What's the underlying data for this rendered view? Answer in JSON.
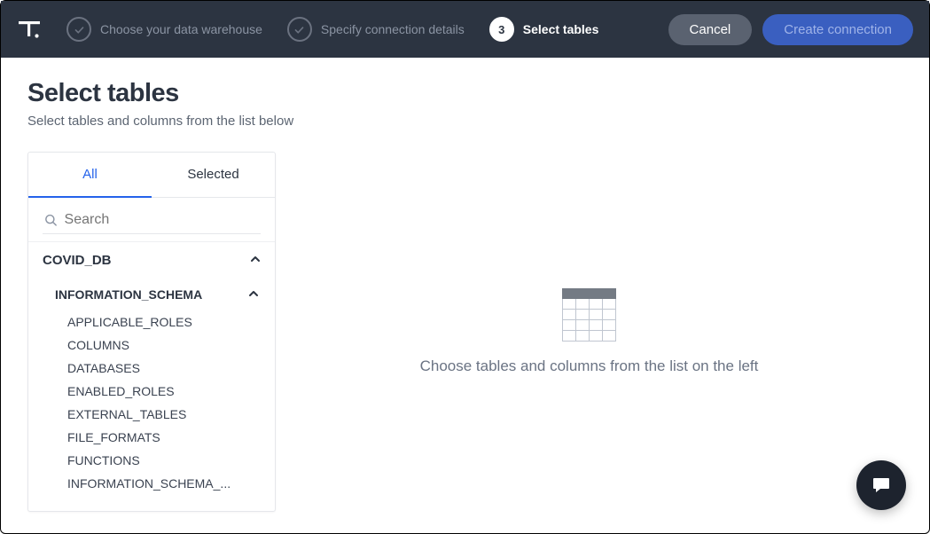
{
  "header": {
    "steps": [
      {
        "label": "Choose your data warehouse",
        "status": "done"
      },
      {
        "label": "Specify connection details",
        "status": "done"
      },
      {
        "label": "Select tables",
        "status": "active",
        "number": "3"
      }
    ],
    "cancel_label": "Cancel",
    "create_label": "Create connection"
  },
  "page": {
    "title": "Select tables",
    "subtitle": "Select tables and columns from the list below"
  },
  "tabs": {
    "all": "All",
    "selected": "Selected"
  },
  "search": {
    "placeholder": "Search"
  },
  "tree": {
    "database": "COVID_DB",
    "schema": "INFORMATION_SCHEMA",
    "tables": [
      "APPLICABLE_ROLES",
      "COLUMNS",
      "DATABASES",
      "ENABLED_ROLES",
      "EXTERNAL_TABLES",
      "FILE_FORMATS",
      "FUNCTIONS",
      "INFORMATION_SCHEMA_..."
    ]
  },
  "empty": {
    "message": "Choose tables and columns from the list on the left"
  }
}
